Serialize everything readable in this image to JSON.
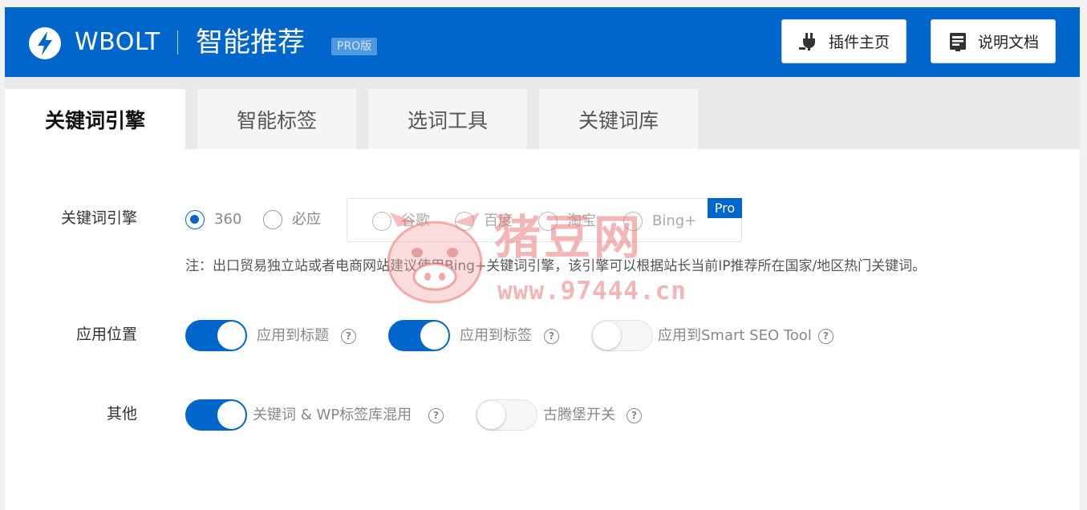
{
  "header": {
    "brand": "WBOLT",
    "title": "智能推荐",
    "badge": "PRO版",
    "buttons": [
      {
        "label": "插件主页",
        "icon": "plug-icon"
      },
      {
        "label": "说明文档",
        "icon": "document-icon"
      }
    ]
  },
  "tabs": [
    {
      "label": "关键词引擎",
      "active": true
    },
    {
      "label": "智能标签",
      "active": false
    },
    {
      "label": "选词工具",
      "active": false
    },
    {
      "label": "关键词库",
      "active": false
    }
  ],
  "engine": {
    "label": "关键词引擎",
    "options": [
      {
        "label": "360",
        "selected": true
      },
      {
        "label": "必应",
        "selected": false
      },
      {
        "label": "谷歌",
        "selected": false,
        "pro": true
      },
      {
        "label": "百度",
        "selected": false,
        "pro": true
      },
      {
        "label": "淘宝",
        "selected": false,
        "pro": true
      },
      {
        "label": "Bing+",
        "selected": false,
        "pro": true
      }
    ],
    "pro_tag": "Pro",
    "note": "注：出口贸易独立站或者电商网站建议使用Bing+关键词引擎，该引擎可以根据站长当前IP推荐所在国家/地区热门关键词。"
  },
  "apply_position": {
    "label": "应用位置",
    "options": [
      {
        "label": "应用到标题",
        "on": true
      },
      {
        "label": "应用到标签",
        "on": true
      },
      {
        "label": "应用到Smart SEO Tool",
        "on": false
      }
    ]
  },
  "other": {
    "label": "其他",
    "options": [
      {
        "label": "关键词 & WP标签库混用",
        "on": true
      },
      {
        "label": "古腾堡开关",
        "on": false
      }
    ]
  },
  "help_glyph": "?",
  "watermark": {
    "text": "猪豆网",
    "url": "www.97444.cn"
  },
  "colors": {
    "primary": "#0066cc",
    "header_bg": "#0066cc",
    "tab_bar_bg": "#e9e9e9",
    "watermark": "#e86c6c"
  }
}
